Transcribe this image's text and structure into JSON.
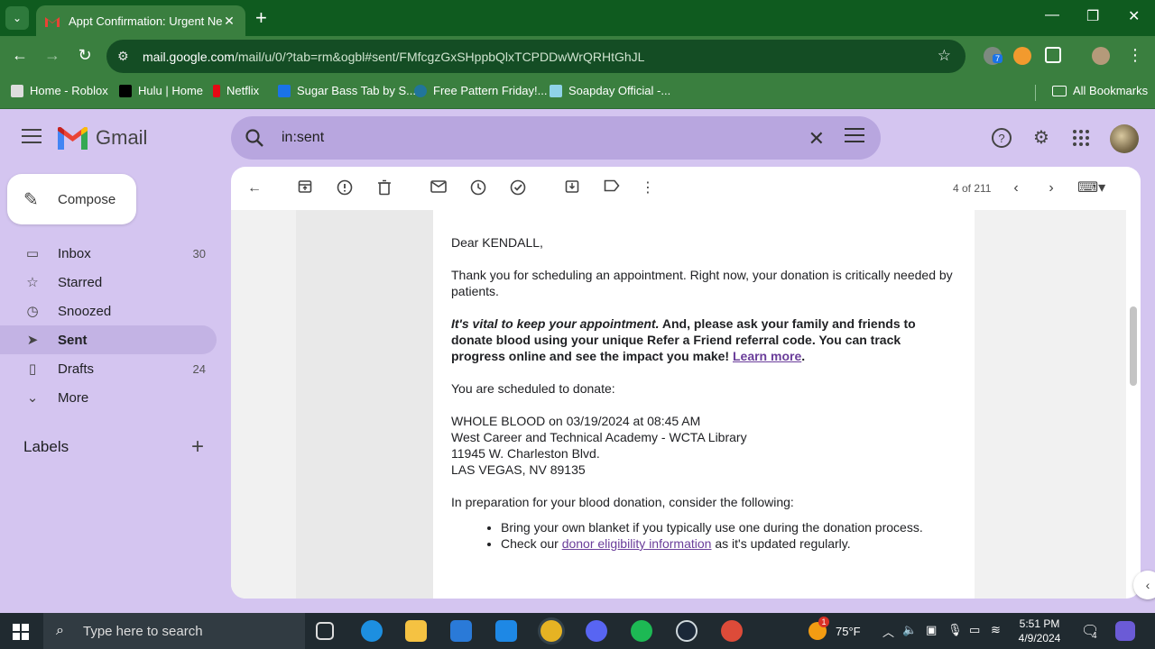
{
  "browser": {
    "tab_title": "Appt Confirmation: Urgent Need",
    "url_host": "mail.google.com",
    "url_path": "/mail/u/0/?tab=rm&ogbl#sent/FMfcgzGxSHppbQlxTCPDDwWrQRHtGhJL",
    "bookmarks": [
      "Home - Roblox",
      "Hulu | Home",
      "Netflix",
      "Sugar Bass Tab by S...",
      "Free Pattern Friday!...",
      "Soapday Official -..."
    ],
    "all_bookmarks": "All Bookmarks",
    "extension_badge": "7"
  },
  "gmail": {
    "brand": "Gmail",
    "search_value": "in:sent",
    "compose_label": "Compose",
    "nav": [
      {
        "label": "Inbox",
        "count": "30"
      },
      {
        "label": "Starred",
        "count": ""
      },
      {
        "label": "Snoozed",
        "count": ""
      },
      {
        "label": "Sent",
        "count": ""
      },
      {
        "label": "Drafts",
        "count": "24"
      },
      {
        "label": "More",
        "count": ""
      }
    ],
    "labels_heading": "Labels",
    "pager": "4 of 211"
  },
  "email": {
    "greeting": "Dear KENDALL,",
    "para1": "Thank you for scheduling an appointment. Right now, your donation is critically needed by patients.",
    "vital_italic": "It's vital to keep your appointment.",
    "vital_rest": " And, please ask your family and friends to donate blood using your unique Refer a Friend referral code. You can track progress online and see the impact you make! ",
    "learn_more": "Learn more",
    "period": ".",
    "scheduled_intro": "You are scheduled to donate:",
    "appt_line1": "WHOLE BLOOD on 03/19/2024 at 08:45 AM",
    "appt_line2": "West Career and Technical Academy - WCTA Library",
    "appt_line3": "11945 W. Charleston Blvd.",
    "appt_line4": "LAS VEGAS, NV 89135",
    "prep_intro": "In preparation for your blood donation, consider the following:",
    "bullet1": "Bring your own blanket if you typically use one during the donation process.",
    "bullet2_pre": "Check our ",
    "bullet2_link": "donor eligibility information",
    "bullet2_post": " as it's updated regularly."
  },
  "taskbar": {
    "search_placeholder": "Type here to search",
    "weather": "75°F",
    "weather_badge": "1",
    "time": "5:51 PM",
    "date": "4/9/2024",
    "notif_count": "4"
  },
  "colors": {
    "chrome_dark": "#0f5b1f",
    "chrome_tab": "#3a7f3f",
    "gmail_bg": "#d4c5f0",
    "link": "#6a3d9a"
  }
}
